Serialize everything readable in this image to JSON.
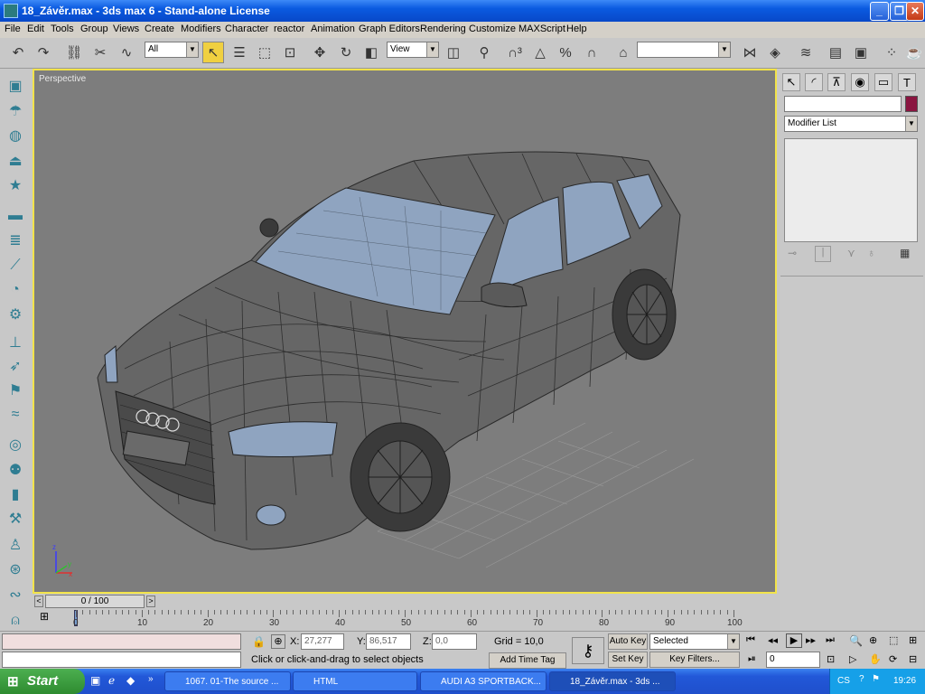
{
  "window": {
    "title": "18_Závěr.max - 3ds max 6 - Stand-alone License",
    "min_icon": "minimize-icon",
    "max_icon": "maximize-icon",
    "close_icon": "close-icon"
  },
  "menu": [
    "File",
    "Edit",
    "Tools",
    "Group",
    "Views",
    "Create",
    "Modifiers",
    "Character",
    "reactor",
    "Animation",
    "Graph Editors",
    "Rendering",
    "Customize",
    "MAXScript",
    "Help"
  ],
  "toolbar": {
    "selection_filter": "All",
    "ref_coord": "View",
    "named_selection": ""
  },
  "viewport": {
    "label": "Perspective",
    "active_color": "#f2e34a",
    "axis_labels": [
      "x",
      "y",
      "z"
    ]
  },
  "command_panel": {
    "tabs": [
      "create-icon",
      "modify-icon",
      "hierarchy-icon",
      "motion-icon",
      "display-icon",
      "utilities-icon"
    ],
    "object_name": "",
    "object_color": "#8a1540",
    "modifier_list": "Modifier List"
  },
  "time_slider": {
    "value": "0 / 100",
    "prev": "<",
    "next": ">"
  },
  "trackbar": {
    "ticks": [
      "0",
      "10",
      "20",
      "30",
      "40",
      "50",
      "60",
      "70",
      "80",
      "90",
      "100"
    ]
  },
  "status": {
    "x_label": "X:",
    "x_value": "27,277",
    "y_label": "Y:",
    "y_value": "86,517",
    "z_label": "Z:",
    "z_value": "0,0",
    "grid": "Grid = 10,0",
    "prompt": "Click or click-and-drag to select objects",
    "add_time_tag": "Add Time Tag",
    "auto_key": "Auto Key",
    "set_key": "Set Key",
    "key_mode": "Selected",
    "key_filters": "Key Filters...",
    "frame": "0"
  },
  "taskbar": {
    "start": "Start",
    "tasks": [
      {
        "label": "1067. 01-The source ..."
      },
      {
        "label": "HTML"
      },
      {
        "label": "AUDI A3 SPORTBACK..."
      },
      {
        "label": "18_Závěr.max - 3ds ..."
      }
    ],
    "lang": "CS",
    "time": "19:26"
  }
}
